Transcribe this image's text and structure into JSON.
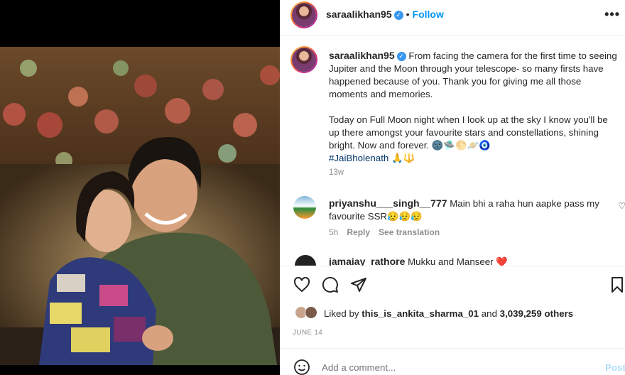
{
  "post": {
    "username": "saraalikhan95",
    "follow_label": "Follow",
    "separator": "•",
    "more_icon": "more-horizontal-icon",
    "verified_icon": "✓"
  },
  "caption": {
    "username": "saraalikhan95",
    "paragraph1": "From facing the camera for the first time to seeing Jupiter and the Moon through your telescope- so many firsts have happened because of you. Thank you for giving me all those moments and memories.",
    "paragraph2": "Today on Full Moon night when I look up at the sky I know you'll be up there amongst your favourite stars and constellations, shining bright. Now and forever. 🌚🛸🌕🪐🧿",
    "hashtag": "#JaiBholenath 🙏🔱",
    "time": "13w"
  },
  "comments": [
    {
      "username": "priyanshu___singh__777",
      "text": "Main bhi a raha hun aapke pass my favourite SSR😥😥😥",
      "time": "5h",
      "reply_label": "Reply",
      "translation_label": "See translation"
    },
    {
      "username": "jamaiay_rathore",
      "text": "Mukku and Manseer ❤️"
    }
  ],
  "likes": {
    "prefix": "Liked by",
    "user": "this_is_ankita_sharma_01",
    "and_label": "and",
    "count": "3,039,259 others"
  },
  "date": "JUNE 14",
  "add_comment": {
    "placeholder": "Add a comment...",
    "post_label": "Post"
  },
  "colors": {
    "accent": "#0095f6",
    "hashtag": "#00376b",
    "muted": "#8e8e8e",
    "post_disabled": "#b2dffc"
  }
}
